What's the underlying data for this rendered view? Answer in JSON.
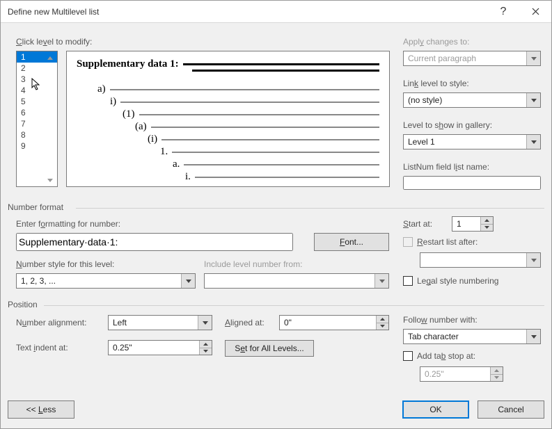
{
  "title": "Define new Multilevel list",
  "clickLevelLabel": "Click level to modify:",
  "levels": [
    "1",
    "2",
    "3",
    "4",
    "5",
    "6",
    "7",
    "8",
    "9"
  ],
  "selectedLevel": "1",
  "preview": {
    "l1": "Supplementary data 1:",
    "l2": "a)",
    "l3": "i)",
    "l4": "(1)",
    "l5": "(a)",
    "l6": "(i)",
    "l7": "1.",
    "l8": "a.",
    "l9": "i."
  },
  "right": {
    "applyChangesLabel": "Apply changes to:",
    "applyChanges": "Current paragraph",
    "linkLevelLabel": "Link level to style:",
    "linkLevel": "(no style)",
    "showGalleryLabel": "Level to show in gallery:",
    "showGallery": "Level 1",
    "listNumLabel": "ListNum field list name:",
    "listNum": ""
  },
  "numberFormat": {
    "sectionLabel": "Number format",
    "enterFormattingLabel": "Enter formatting for number:",
    "formatValue": "Supplementary·data·1:",
    "fontBtn": "Font...",
    "numberStyleLabel": "Number style for this level:",
    "numberStyle": "1, 2, 3, ...",
    "includeLevelLabel": "Include level number from:",
    "includeLevel": "",
    "startAtLabel": "Start at:",
    "startAt": "1",
    "restartLabel": "Restart list after:",
    "restartVal": "",
    "legalLabel": "Legal style numbering"
  },
  "position": {
    "sectionLabel": "Position",
    "numberAlignLabel": "Number alignment:",
    "numberAlign": "Left",
    "alignedAtLabel": "Aligned at:",
    "alignedAt": "0\"",
    "textIndentLabel": "Text indent at:",
    "textIndent": "0.25\"",
    "setAllBtn": "Set for All Levels...",
    "followLabel": "Follow number with:",
    "followVal": "Tab character",
    "addTabLabel": "Add tab stop at:",
    "addTab": "0.25\""
  },
  "buttons": {
    "less": "<< Less",
    "ok": "OK",
    "cancel": "Cancel"
  }
}
